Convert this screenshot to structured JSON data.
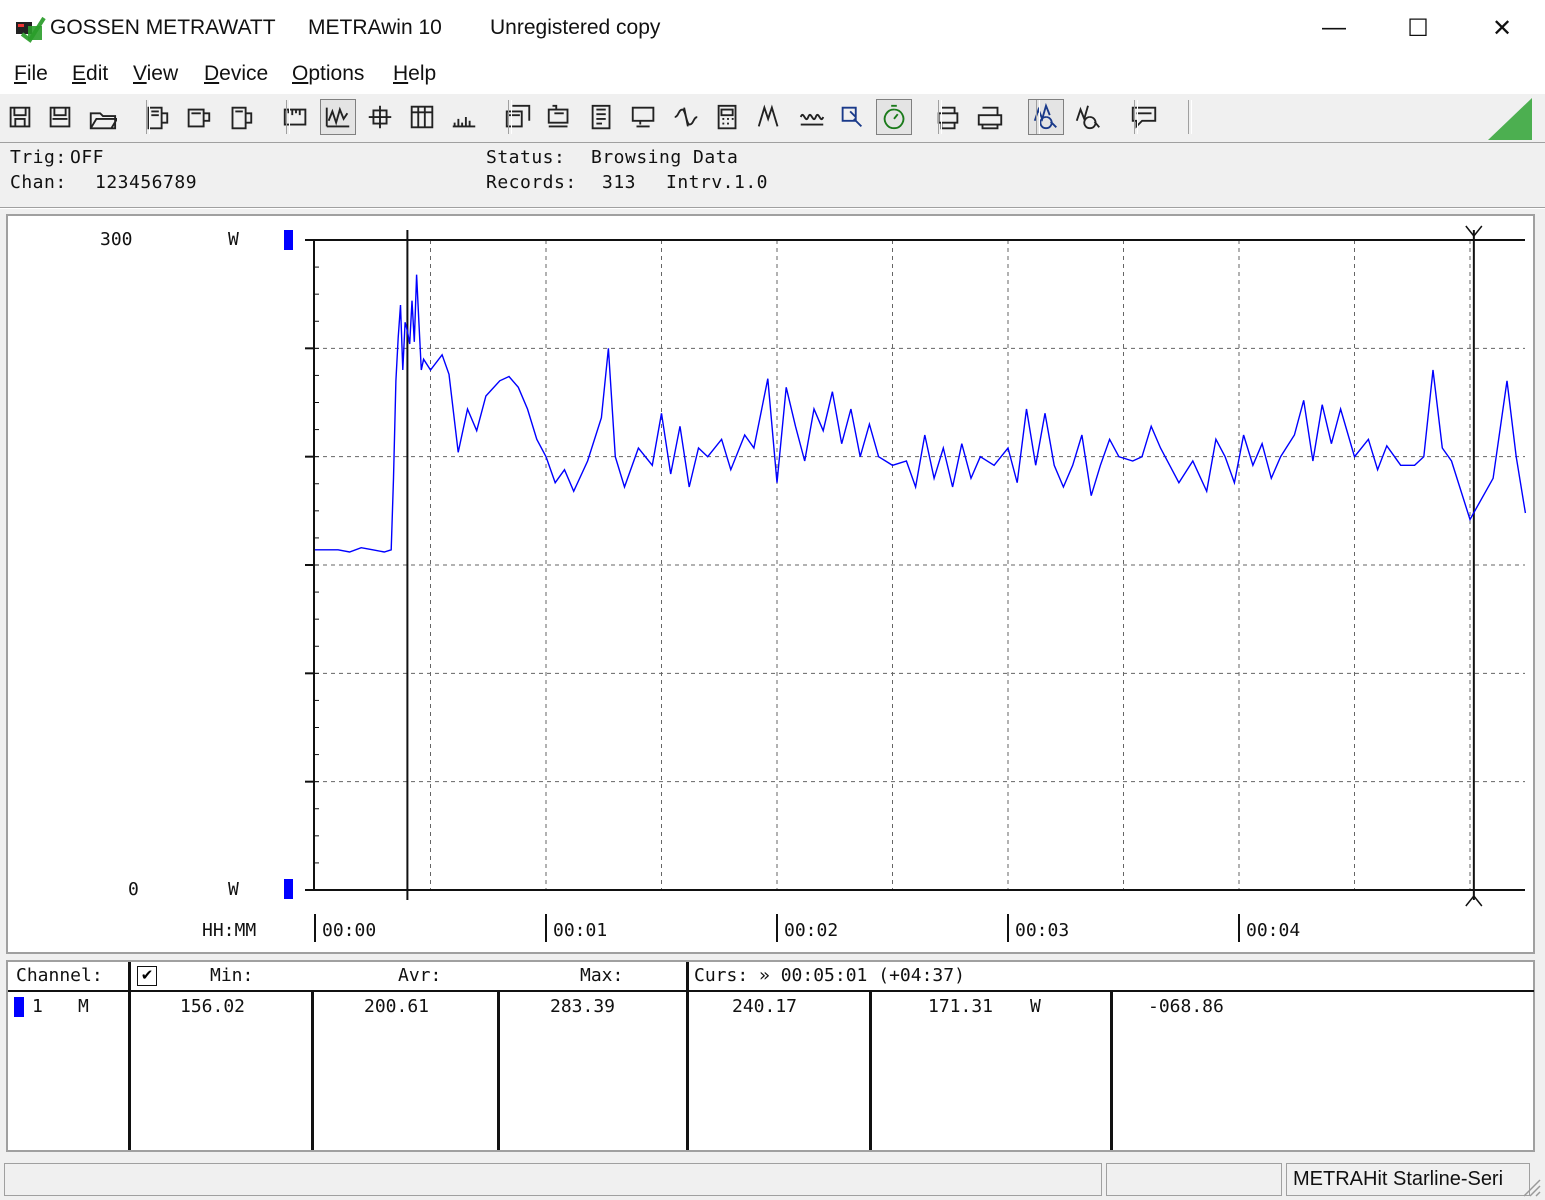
{
  "window": {
    "vendor": "GOSSEN METRAWATT",
    "app": "METRAwin 10",
    "license": "Unregistered copy",
    "minimize_glyph": "—",
    "maximize_glyph": "☐",
    "close_glyph": "✕"
  },
  "menu": {
    "file": {
      "key": "F",
      "rest": "ile"
    },
    "edit": {
      "key": "E",
      "rest": "dit"
    },
    "view": {
      "key": "V",
      "rest": "iew"
    },
    "device": {
      "key": "D",
      "rest": "evice"
    },
    "options": {
      "key": "O",
      "rest": "ptions"
    },
    "help": {
      "key": "H",
      "rest": "elp"
    }
  },
  "toolbar": {
    "icons": [
      "save-icon",
      "save-as-icon",
      "open-icon",
      "device-read-icon",
      "device-config-icon",
      "device-send-icon",
      "scale-icon",
      "wave-view-icon",
      "crosshair-icon",
      "table-view-icon",
      "histogram-icon",
      "window-icon",
      "settings-icon",
      "list-icon",
      "monitor-icon",
      "formula-icon",
      "calculator-icon",
      "filter-icon",
      "pattern-icon",
      "cursor-zoom-icon",
      "timer-icon",
      "print-preview-icon",
      "print-icon",
      "zoom-in-icon",
      "zoom-out-icon",
      "message-icon"
    ],
    "accent_color": "#4caf50"
  },
  "status": {
    "trig_label": "Trig:",
    "trig_value": "OFF",
    "chan_label": "Chan:",
    "chan_value": "123456789",
    "status_label": "Status:",
    "status_value": "Browsing Data",
    "records_label": "Records:",
    "records_value": "313",
    "interval_label": "Intrv.",
    "interval_value": "1.0"
  },
  "axis": {
    "y_max": "300",
    "y_min": "0",
    "y_unit": "W",
    "x_label": "HH:MM",
    "series_color": "#0000ff"
  },
  "chart_data": {
    "type": "line",
    "ylim": [
      0,
      300
    ],
    "xlim_minutes": [
      0,
      5.25
    ],
    "x_ticks": [
      "00:00",
      "00:01",
      "00:02",
      "00:03",
      "00:04"
    ],
    "cursor_times": [
      "00:00:24",
      "00:05:01"
    ],
    "series": [
      {
        "values": [
          [
            0.0,
            157
          ],
          [
            0.1,
            157
          ],
          [
            0.15,
            156
          ],
          [
            0.2,
            158
          ],
          [
            0.25,
            157
          ],
          [
            0.3,
            156
          ],
          [
            0.33,
            157
          ],
          [
            0.34,
            190
          ],
          [
            0.35,
            235
          ],
          [
            0.36,
            255
          ],
          [
            0.37,
            270
          ],
          [
            0.38,
            240
          ],
          [
            0.39,
            262
          ],
          [
            0.4,
            258
          ],
          [
            0.41,
            252
          ],
          [
            0.42,
            272
          ],
          [
            0.43,
            253
          ],
          [
            0.44,
            284
          ],
          [
            0.45,
            262
          ],
          [
            0.46,
            240
          ],
          [
            0.47,
            245
          ],
          [
            0.5,
            240
          ],
          [
            0.55,
            247
          ],
          [
            0.58,
            238
          ],
          [
            0.62,
            202
          ],
          [
            0.66,
            222
          ],
          [
            0.7,
            212
          ],
          [
            0.74,
            228
          ],
          [
            0.8,
            235
          ],
          [
            0.84,
            237
          ],
          [
            0.88,
            232
          ],
          [
            0.92,
            222
          ],
          [
            0.96,
            208
          ],
          [
            1.0,
            200
          ],
          [
            1.04,
            188
          ],
          [
            1.08,
            194
          ],
          [
            1.12,
            184
          ],
          [
            1.18,
            198
          ],
          [
            1.24,
            218
          ],
          [
            1.27,
            250
          ],
          [
            1.3,
            200
          ],
          [
            1.34,
            186
          ],
          [
            1.4,
            204
          ],
          [
            1.46,
            196
          ],
          [
            1.5,
            220
          ],
          [
            1.54,
            192
          ],
          [
            1.58,
            214
          ],
          [
            1.62,
            186
          ],
          [
            1.66,
            204
          ],
          [
            1.7,
            200
          ],
          [
            1.76,
            208
          ],
          [
            1.8,
            194
          ],
          [
            1.86,
            210
          ],
          [
            1.9,
            204
          ],
          [
            1.96,
            236
          ],
          [
            2.0,
            188
          ],
          [
            2.04,
            232
          ],
          [
            2.08,
            214
          ],
          [
            2.12,
            198
          ],
          [
            2.16,
            222
          ],
          [
            2.2,
            212
          ],
          [
            2.24,
            230
          ],
          [
            2.28,
            206
          ],
          [
            2.32,
            222
          ],
          [
            2.36,
            200
          ],
          [
            2.4,
            215
          ],
          [
            2.44,
            200
          ],
          [
            2.5,
            196
          ],
          [
            2.56,
            198
          ],
          [
            2.6,
            186
          ],
          [
            2.64,
            210
          ],
          [
            2.68,
            190
          ],
          [
            2.72,
            204
          ],
          [
            2.76,
            186
          ],
          [
            2.8,
            206
          ],
          [
            2.84,
            190
          ],
          [
            2.88,
            200
          ],
          [
            2.94,
            196
          ],
          [
            3.0,
            204
          ],
          [
            3.04,
            188
          ],
          [
            3.08,
            222
          ],
          [
            3.12,
            196
          ],
          [
            3.16,
            220
          ],
          [
            3.2,
            196
          ],
          [
            3.24,
            186
          ],
          [
            3.28,
            196
          ],
          [
            3.32,
            210
          ],
          [
            3.36,
            182
          ],
          [
            3.4,
            196
          ],
          [
            3.44,
            208
          ],
          [
            3.48,
            200
          ],
          [
            3.54,
            198
          ],
          [
            3.58,
            200
          ],
          [
            3.62,
            214
          ],
          [
            3.66,
            204
          ],
          [
            3.7,
            196
          ],
          [
            3.74,
            188
          ],
          [
            3.8,
            198
          ],
          [
            3.86,
            184
          ],
          [
            3.9,
            208
          ],
          [
            3.94,
            200
          ],
          [
            3.98,
            188
          ],
          [
            4.02,
            210
          ],
          [
            4.06,
            196
          ],
          [
            4.1,
            206
          ],
          [
            4.14,
            190
          ],
          [
            4.18,
            200
          ],
          [
            4.24,
            210
          ],
          [
            4.28,
            226
          ],
          [
            4.32,
            198
          ],
          [
            4.36,
            224
          ],
          [
            4.4,
            206
          ],
          [
            4.44,
            222
          ],
          [
            4.5,
            200
          ],
          [
            4.56,
            208
          ],
          [
            4.6,
            194
          ],
          [
            4.64,
            205
          ],
          [
            4.7,
            196
          ],
          [
            4.76,
            196
          ],
          [
            4.8,
            200
          ],
          [
            4.84,
            240
          ],
          [
            4.88,
            204
          ],
          [
            4.92,
            198
          ],
          [
            5.0,
            171
          ],
          [
            5.1,
            190
          ],
          [
            5.16,
            235
          ],
          [
            5.2,
            200
          ],
          [
            5.24,
            174
          ]
        ]
      }
    ]
  },
  "table": {
    "channel_header": "Channel:",
    "checkbox_checked": "✔",
    "min_header": "Min:",
    "avr_header": "Avr:",
    "max_header": "Max:",
    "curs_header": "Curs: » 00:05:01 (+04:37)",
    "rows": [
      {
        "channel": "1",
        "mode": "M",
        "min": "156.02",
        "avr": "200.61",
        "max": "283.39",
        "cursor1": "240.17",
        "cursor2": "171.31",
        "unit": "W",
        "delta": "-068.86"
      }
    ]
  },
  "statusbar": {
    "panel3": "METRAHit Starline-Seri"
  }
}
